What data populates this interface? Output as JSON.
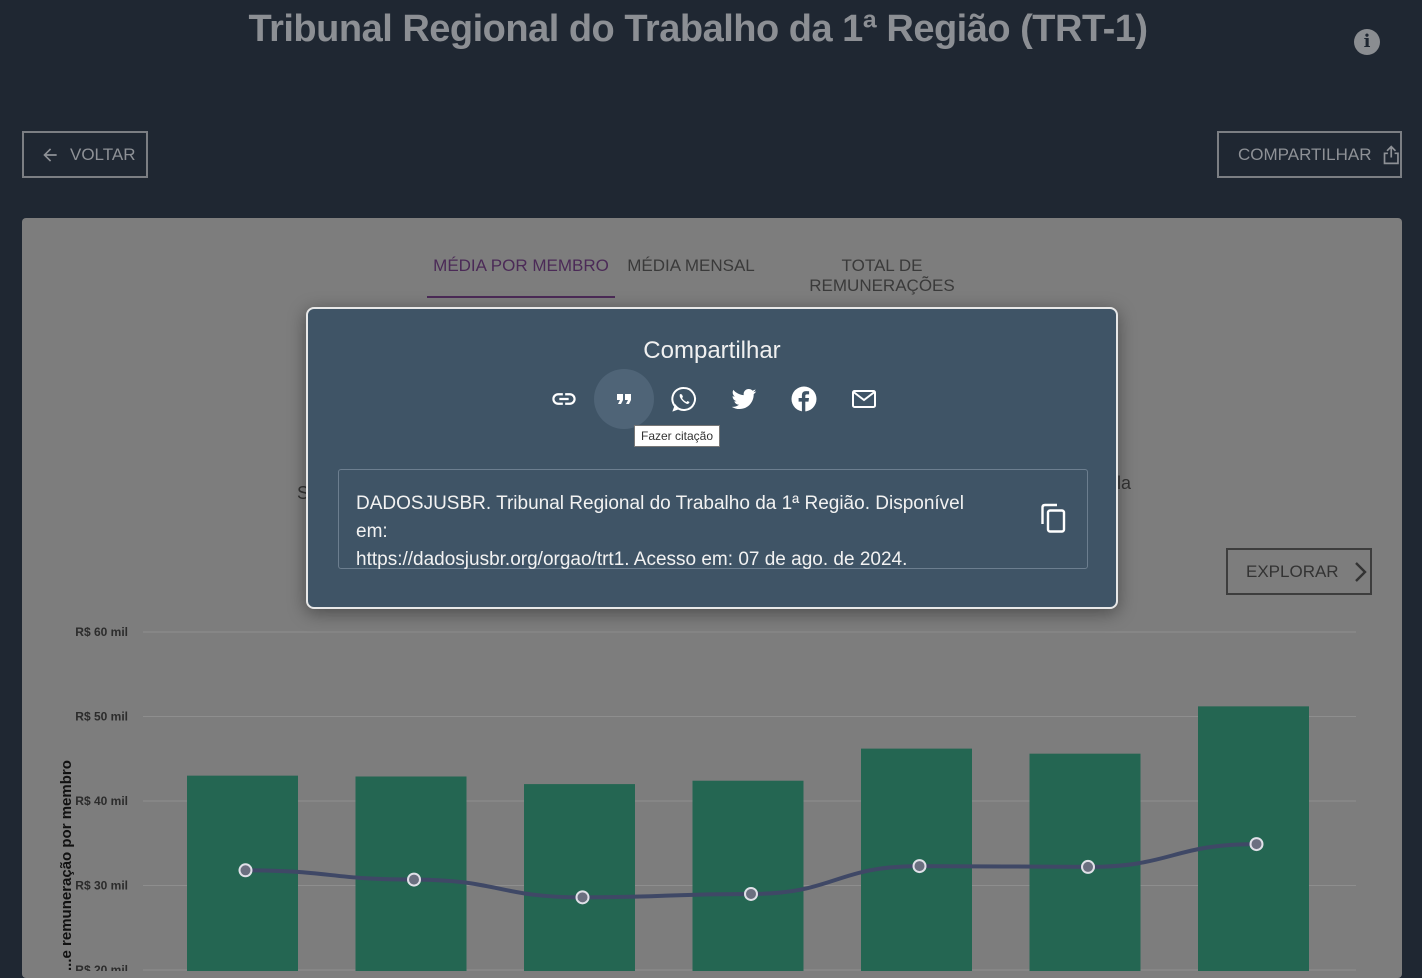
{
  "header": {
    "title": "Tribunal Regional do Trabalho da 1ª Região (TRT-1)",
    "info_icon": "i"
  },
  "toolbar": {
    "back_label": "VOLTAR",
    "share_label": "COMPARTILHAR"
  },
  "tabs": [
    {
      "label": "MÉDIA POR MEMBRO",
      "active": true
    },
    {
      "label": "MÉDIA MENSAL",
      "active": false
    },
    {
      "label": "TOTAL DE REMUNERAÇÕES",
      "active": false
    }
  ],
  "panel": {
    "partial_left": "S",
    "partial_right": "la",
    "explore_label": "EXPLORAR"
  },
  "modal": {
    "title": "Compartilhar",
    "icons": [
      "link-icon",
      "quote-icon",
      "whatsapp-icon",
      "twitter-icon",
      "facebook-icon",
      "email-icon"
    ],
    "tooltip": "Fazer citação",
    "citation_line1": "DADOSJUSBR. Tribunal Regional do Trabalho da 1ª Região. Disponível em:",
    "citation_line2": "https://dadosjusbr.org/orgao/trt1.  Acesso em: 07 de ago. de 2024.",
    "copy_icon": "copy-icon"
  },
  "colors": {
    "background": "#1f2732",
    "panel": "#7d7d7d",
    "modal": "#3f5466",
    "bar": "#246652",
    "line": "#3f4866",
    "active_tab": "#4b2a57"
  },
  "chart_data": {
    "type": "bar",
    "ylabel": "...e remuneração por membro",
    "yticks": [
      "R$ 60 mil",
      "R$ 50 mil",
      "R$ 40 mil",
      "R$ 30 mil",
      "R$ 20 mil"
    ],
    "ytick_values": [
      60,
      50,
      40,
      30,
      20
    ],
    "ylim": [
      20,
      60
    ],
    "series": [
      {
        "values": [
          43.0,
          42.9,
          42.0,
          42.4,
          46.2,
          45.6,
          51.2
        ]
      },
      {
        "type": "line",
        "values": [
          31.8,
          30.7,
          28.6,
          29.0,
          32.3,
          32.2,
          34.9
        ]
      }
    ],
    "grid": true
  }
}
